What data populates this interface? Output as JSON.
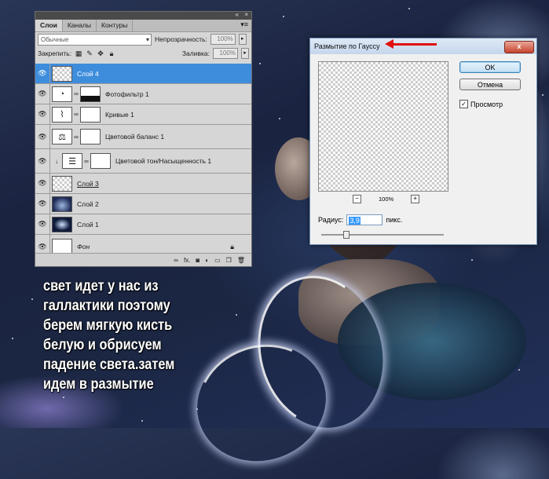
{
  "layers_panel": {
    "tabs": [
      "Слои",
      "Каналы",
      "Контуры"
    ],
    "topbar_collapse": "«",
    "topbar_close": "×",
    "menu_icon": "panel-menu-icon",
    "blend_mode": "Обычные",
    "opacity_label": "Непрозрачность:",
    "opacity_value": "100%",
    "lock_label": "Закрепить:",
    "fill_label": "Заливка:",
    "fill_value": "100%",
    "layers": [
      {
        "name": "Слой 4",
        "type": "pixel",
        "selected": true
      },
      {
        "name": "Фотофильтр 1",
        "type": "adjustment",
        "selected": false
      },
      {
        "name": "Кривые 1",
        "type": "adjustment",
        "selected": false
      },
      {
        "name": "Цветовой баланс 1",
        "type": "adjustment",
        "selected": false
      },
      {
        "name": "Цветовой тон/Насыщенность 1",
        "type": "adjustment",
        "selected": false
      },
      {
        "name": "Слой 3",
        "type": "pixel",
        "selected": false
      },
      {
        "name": "Слой 2",
        "type": "pixel",
        "selected": false
      },
      {
        "name": "Слой 1",
        "type": "pixel",
        "selected": false
      },
      {
        "name": "Фон",
        "type": "background",
        "selected": false
      }
    ],
    "bottom_icons": [
      "link-icon",
      "fx-icon",
      "mask-icon",
      "adjustment-icon",
      "group-icon",
      "new-layer-icon",
      "trash-icon"
    ],
    "bottom_fx": "fx."
  },
  "gauss_dialog": {
    "title": "Размытие по Гауссу",
    "close_label": "x",
    "ok_label": "OK",
    "cancel_label": "Отмена",
    "preview_label": "Просмотр",
    "preview_checked": true,
    "zoom_minus": "−",
    "zoom_plus": "+",
    "zoom_value": "100%",
    "radius_label": "Радиус:",
    "radius_value": "3,9",
    "radius_unit": "пикс.",
    "slider_level": 0.2
  },
  "annotation": {
    "arrow_color": "#e01010"
  },
  "caption": "свет идет у нас из\nгаллактики поэтому\nберем мягкую кисть\nбелую и обрисуем\nпадение света.затем\nидем в размытие",
  "colors": {
    "selection": "#3e8ddd",
    "panel_bg": "#d6d6d6",
    "background": "#1b2642"
  }
}
